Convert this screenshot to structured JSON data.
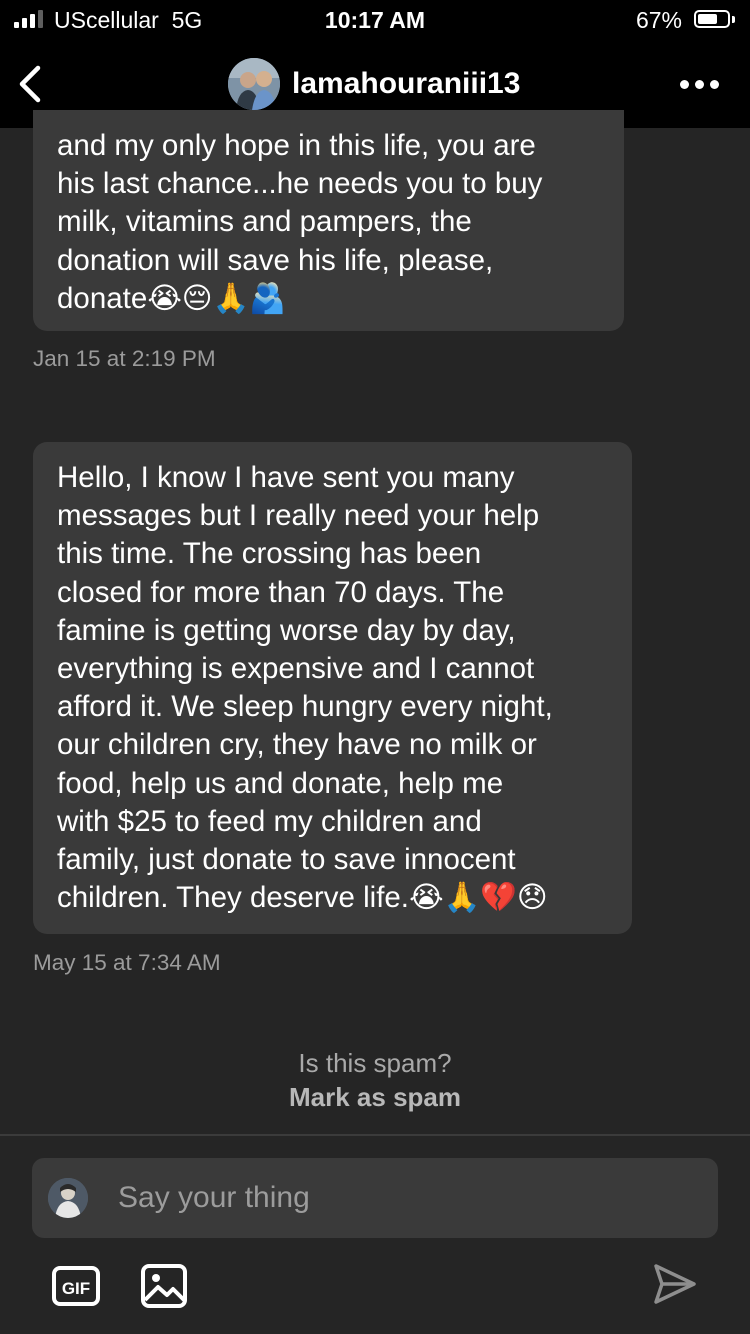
{
  "status_bar": {
    "carrier": "UScellular",
    "network": "5G",
    "time": "10:17 AM",
    "battery": "67%",
    "battery_level": 0.67,
    "signal_bars": 3
  },
  "header": {
    "username": "lamahouraniii13",
    "back_icon": "chevron-left-icon",
    "more_icon": "more-horizontal-icon"
  },
  "messages": [
    {
      "text": "and my only hope in this life, you are\nhis last chance...he needs you to buy\nmilk, vitamins and pampers, the\ndonation will save his life, please,\ndonate😭😔🙏🫂",
      "timestamp": "Jan 15 at 2:19 PM"
    },
    {
      "text": "Hello, I know I have sent you many\nmessages but I really need your help\nthis time. The crossing has been\nclosed for more than 70 days. The\nfamine is getting worse day by day,\neverything is expensive and I cannot\nafford it. We sleep hungry every night,\nour children cry, they have no milk or\nfood, help us and donate, help me\nwith $25 to feed my children and\nfamily, just donate to save innocent\nchildren. They deserve life.😭🙏💔😞",
      "timestamp": "May 15 at 7:34 AM"
    }
  ],
  "spam": {
    "question": "Is this spam?",
    "action": "Mark as spam"
  },
  "composer": {
    "placeholder": "Say your thing"
  },
  "colors": {
    "background": "#252525",
    "bubble": "#3a3a3a",
    "bar": "#000000",
    "muted_text": "#9b9b9b"
  }
}
